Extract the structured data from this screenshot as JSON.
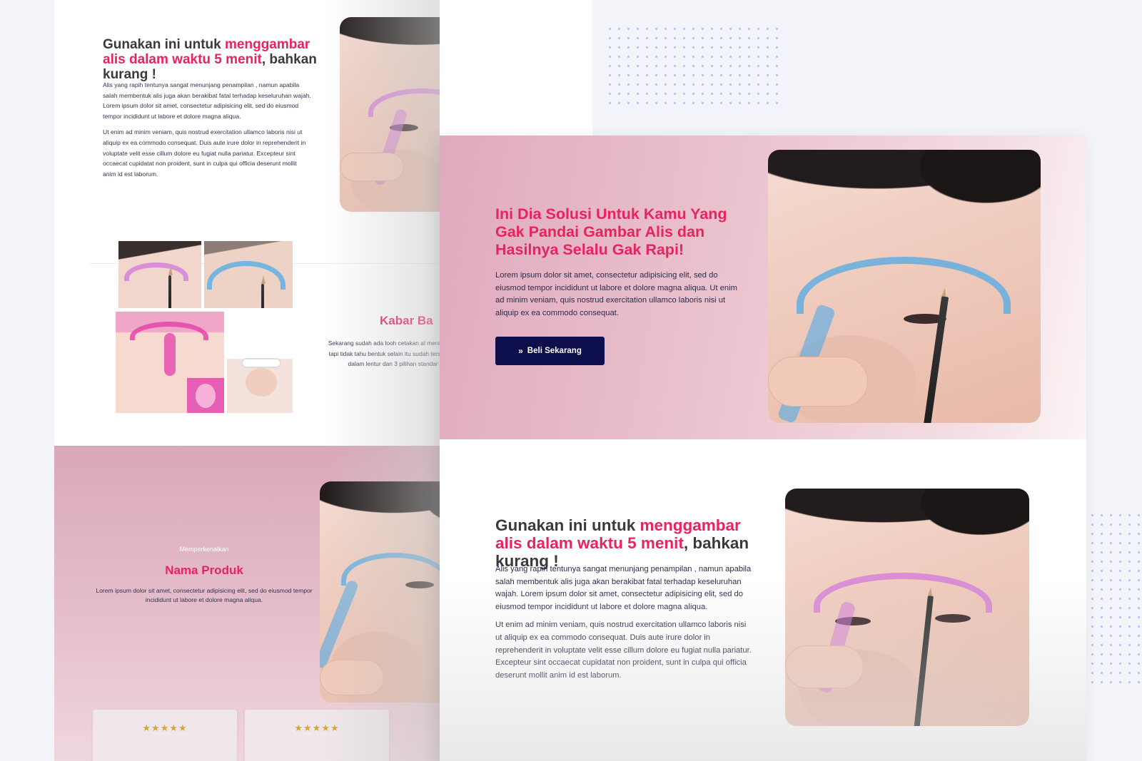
{
  "colors": {
    "accent_pink": "#e8235d",
    "button_navy": "#0d0f4c",
    "hero_pink": "#dfaabe",
    "star_gold": "#d4a73a"
  },
  "icons": {
    "star": "★",
    "button_icon": "»"
  },
  "back_panel": {
    "section1": {
      "heading_prefix": "Gunakan ini untuk ",
      "heading_highlight": "menggambar alis dalam waktu 5 menit",
      "heading_suffix": ", bahkan kurang !",
      "paragraph1": "Alis yang rapih tentunya sangat menunjang penampilan , namun apabila salah membentuk alis juga akan berakibat fatal terhadap keseluruhan wajah. Lorem ipsum dolor sit amet, consectetur adipisicing elit, sed do eiusmod tempor incididunt ut labore et dolore magna aliqua.",
      "paragraph2": "Ut enim ad minim veniam, quis nostrud exercitation ullamco laboris nisi ut aliquip ex ea commodo consequat. Duis aute irure dolor in reprehenderit in voluptate velit esse cillum dolore eu fugiat nulla pariatur. Excepteur sint occaecat cupidatat non proident, sunt in culpa qui officia deserunt mollit anim id est laborum."
    },
    "news": {
      "title": "Kabar Ba",
      "body": "Sekarang sudah ada looh cetakan al merapikan alis tapi tidak tahu bentuk selain itu sudah tersedia juga dalam lentur dan 3 pilihan standar ali"
    },
    "product": {
      "intro": "Memperkenalkan",
      "name": "Nama Produk",
      "description": "Lorem ipsum dolor sit amet, consectetur adipisicing elit, sed do eiusmod tempor incididunt ut labore et dolore magna aliqua."
    },
    "reviews": [
      {
        "stars": "★★★★★"
      },
      {
        "stars": "★★★★★"
      }
    ]
  },
  "front_panel": {
    "hero": {
      "title": "Ini Dia Solusi Untuk Kamu Yang Gak Pandai Gambar Alis dan Hasilnya Selalu Gak Rapi!",
      "body": "Lorem ipsum dolor sit amet, consectetur adipisicing elit, sed do eiusmod tempor incididunt ut labore et dolore magna aliqua. Ut enim ad minim veniam, quis nostrud exercitation ullamco laboris nisi ut aliquip ex ea commodo consequat.",
      "button_label": "Beli Sekarang"
    },
    "section2": {
      "heading_prefix": "Gunakan ini untuk ",
      "heading_highlight": "menggambar alis dalam waktu 5 menit",
      "heading_suffix": ", bahkan kurang !",
      "paragraph1": "Alis yang rapih tentunya sangat menunjang penampilan , namun apabila salah membentuk alis juga akan berakibat fatal terhadap keseluruhan wajah. Lorem ipsum dolor sit amet, consectetur adipisicing elit, sed do eiusmod tempor incididunt ut labore et dolore magna aliqua.",
      "paragraph2": "Ut enim ad minim veniam, quis nostrud exercitation ullamco laboris nisi ut aliquip ex ea commodo consequat. Duis aute irure dolor in reprehenderit in voluptate velit esse cillum dolore eu fugiat nulla pariatur. Excepteur sint occaecat cupidatat non proident, sunt in culpa qui officia deserunt mollit anim id est laborum."
    }
  }
}
